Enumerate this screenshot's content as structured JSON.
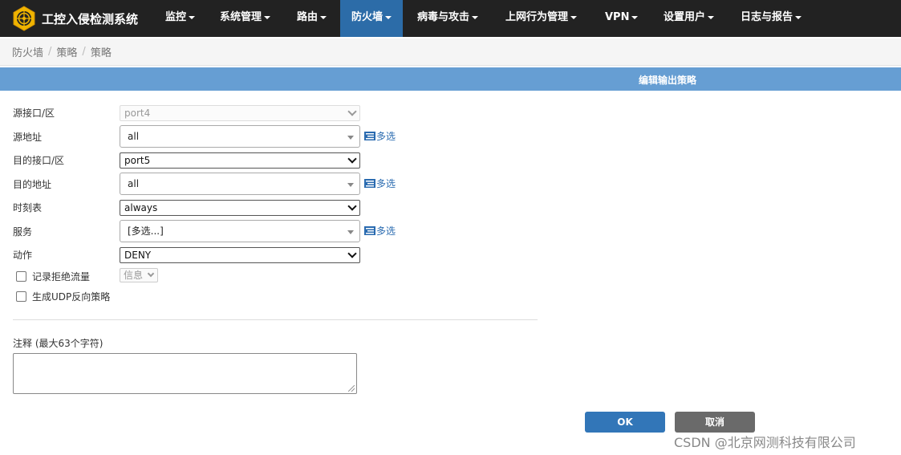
{
  "app": {
    "title": "工控入侵检测系统"
  },
  "nav": {
    "items": [
      {
        "label": "监控",
        "caret": true
      },
      {
        "label": "系统管理",
        "caret": true
      },
      {
        "label": "路由",
        "caret": true
      },
      {
        "label": "防火墙",
        "caret": true,
        "active": true
      },
      {
        "label": "病毒与攻击",
        "caret": true
      },
      {
        "label": "上网行为管理",
        "caret": true
      },
      {
        "label": "VPN",
        "caret": true
      },
      {
        "label": "设置用户",
        "caret": true
      },
      {
        "label": "日志与报告",
        "caret": true
      }
    ]
  },
  "breadcrumb": [
    "防火墙",
    "策略",
    "策略"
  ],
  "page": {
    "title": "编辑输出策略"
  },
  "form": {
    "src_intf": {
      "label": "源接口/区",
      "value": "port4",
      "disabled": true
    },
    "src_addr": {
      "label": "源地址",
      "value": "all",
      "multi_label": "多选"
    },
    "dst_intf": {
      "label": "目的接口/区",
      "value": "port5"
    },
    "dst_addr": {
      "label": "目的地址",
      "value": "all",
      "multi_label": "多选"
    },
    "schedule": {
      "label": "时刻表",
      "value": "always"
    },
    "service": {
      "label": "服务",
      "value": "[多选...]",
      "multi_label": "多选"
    },
    "action": {
      "label": "动作",
      "value": "DENY"
    },
    "log_deny": {
      "label": "记录拒绝流量",
      "checked": false,
      "level": "信息"
    },
    "udp_reverse": {
      "label": "生成UDP反向策略",
      "checked": false
    },
    "comment": {
      "label": "注释 (最大63个字符)",
      "value": ""
    }
  },
  "buttons": {
    "ok": "OK",
    "cancel": "取消"
  },
  "watermark": "CSDN @北京网测科技有限公司",
  "colors": {
    "navbar": "#222222",
    "nav_active": "#2c6ca8",
    "titlebar": "#669ed3",
    "ok": "#3276b8",
    "cancel": "#6a6a6a",
    "link": "#2a6bb0"
  }
}
